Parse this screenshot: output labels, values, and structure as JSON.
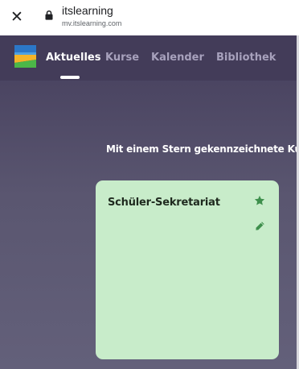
{
  "browser": {
    "close_glyph": "✕",
    "title": "itslearning",
    "url": "mv.itslearning.com",
    "icons": {
      "close": "close-icon",
      "lock": "lock-icon"
    }
  },
  "nav": {
    "logo": "itslearning-logo",
    "tabs": [
      {
        "label": "Aktuelles",
        "active": true
      },
      {
        "label": "Kurse",
        "active": false
      },
      {
        "label": "Kalender",
        "active": false
      },
      {
        "label": "Bibliothek",
        "active": false
      }
    ]
  },
  "main": {
    "starred_hint": "Mit einem Stern gekennzeichnete Ku",
    "course_card": {
      "title": "Schüler-Sekretariat",
      "starred": true,
      "icons": {
        "star": "star-icon",
        "edit": "pencil-icon"
      }
    }
  },
  "colors": {
    "nav_background": "#433c59",
    "page_background": "#4b4562",
    "card_background": "#c8ecca",
    "icon_green": "#3e8f4c",
    "tab_inactive": "#a7a1bc"
  }
}
